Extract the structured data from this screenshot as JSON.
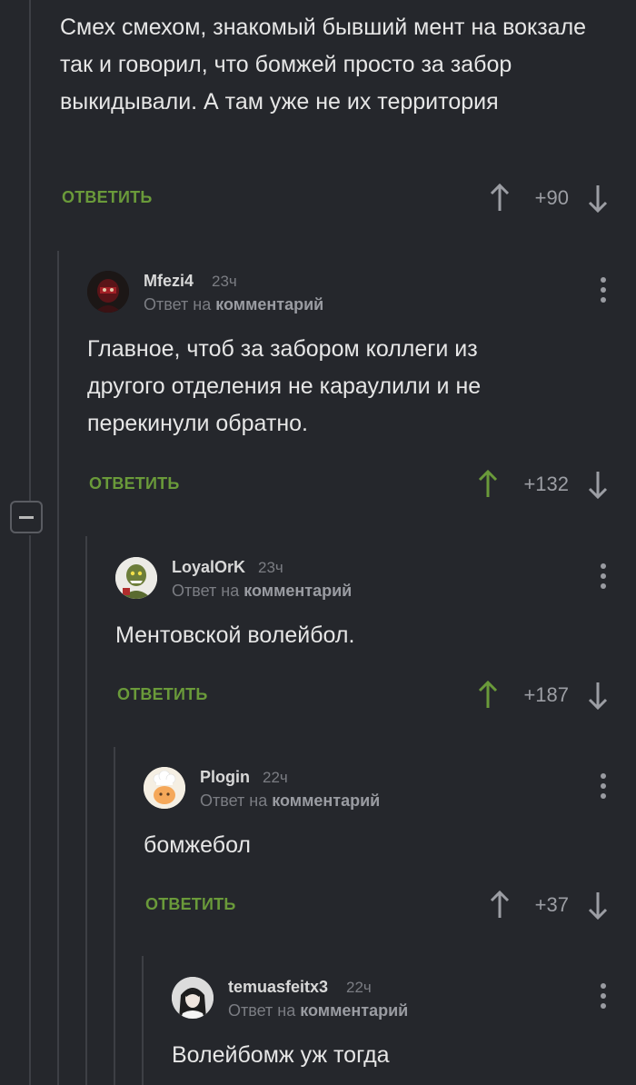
{
  "colors": {
    "background": "#25272c",
    "accent_green": "#6a9a3a",
    "upvoted": "#6a9a3a",
    "muted": "#7b7d83"
  },
  "root": {
    "text": "Смех смехом, знакомый бывший мент на вокзале так и говорил, что бомжей просто за забор выкидывали. А там уже не их территория",
    "reply_label": "ОТВЕТИТЬ",
    "rating": "+90",
    "upvoted": false
  },
  "comments": [
    {
      "author": "Mfezi4",
      "time": "23ч",
      "reply_prefix": "Ответ на",
      "reply_target": "комментарий",
      "text": "Главное, чтоб за забором коллеги из другого отделения не караулили и не перекинули обратно.",
      "reply_label": "ОТВЕТИТЬ",
      "rating": "+132",
      "upvoted": true,
      "avatar": "dark-red-figure-avatar"
    },
    {
      "author": "LoyalOrK",
      "time": "23ч",
      "reply_prefix": "Ответ на",
      "reply_target": "комментарий",
      "text": "Ментовской волейбол.",
      "reply_label": "ОТВЕТИТЬ",
      "rating": "+187",
      "upvoted": true,
      "avatar": "orc-avatar"
    },
    {
      "author": "Plogin",
      "time": "22ч",
      "reply_prefix": "Ответ на",
      "reply_target": "комментарий",
      "text": "бомжебол",
      "reply_label": "ОТВЕТИТЬ",
      "rating": "+37",
      "upvoted": false,
      "avatar": "chef-avatar"
    },
    {
      "author": "temuasfeitx3",
      "time": "22ч",
      "reply_prefix": "Ответ на",
      "reply_target": "комментарий",
      "text": "Волейбомж уж тогда",
      "avatar": "anime-girl-avatar"
    }
  ]
}
